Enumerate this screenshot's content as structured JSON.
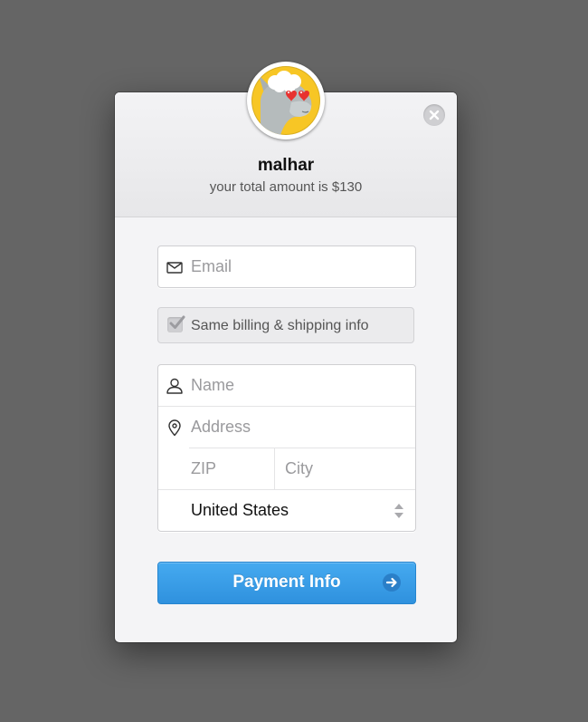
{
  "checkout": {
    "shop_name": "malhar",
    "amount_text": "your total amount is $130",
    "email_placeholder": "Email",
    "billing_label": "Same billing & shipping info",
    "billing_checked": true,
    "name_placeholder": "Name",
    "address_placeholder": "Address",
    "zip_placeholder": "ZIP",
    "city_placeholder": "City",
    "country_value": "United States",
    "submit_label": "Payment Info"
  },
  "icons": {
    "avatar": "llama-heart-eyes-avatar",
    "close": "close-icon",
    "email": "envelope-icon",
    "checkbox": "checkmark-icon",
    "name": "person-icon",
    "address": "location-pin-icon",
    "select": "select-arrows-icon",
    "submit": "arrow-right-icon"
  },
  "colors": {
    "overlay_background": "#656565",
    "modal_background": "#f4f4f6",
    "avatar_background": "#f7c625",
    "button_primary": "#3a9fe8",
    "placeholder_text": "#9a9a9d"
  }
}
